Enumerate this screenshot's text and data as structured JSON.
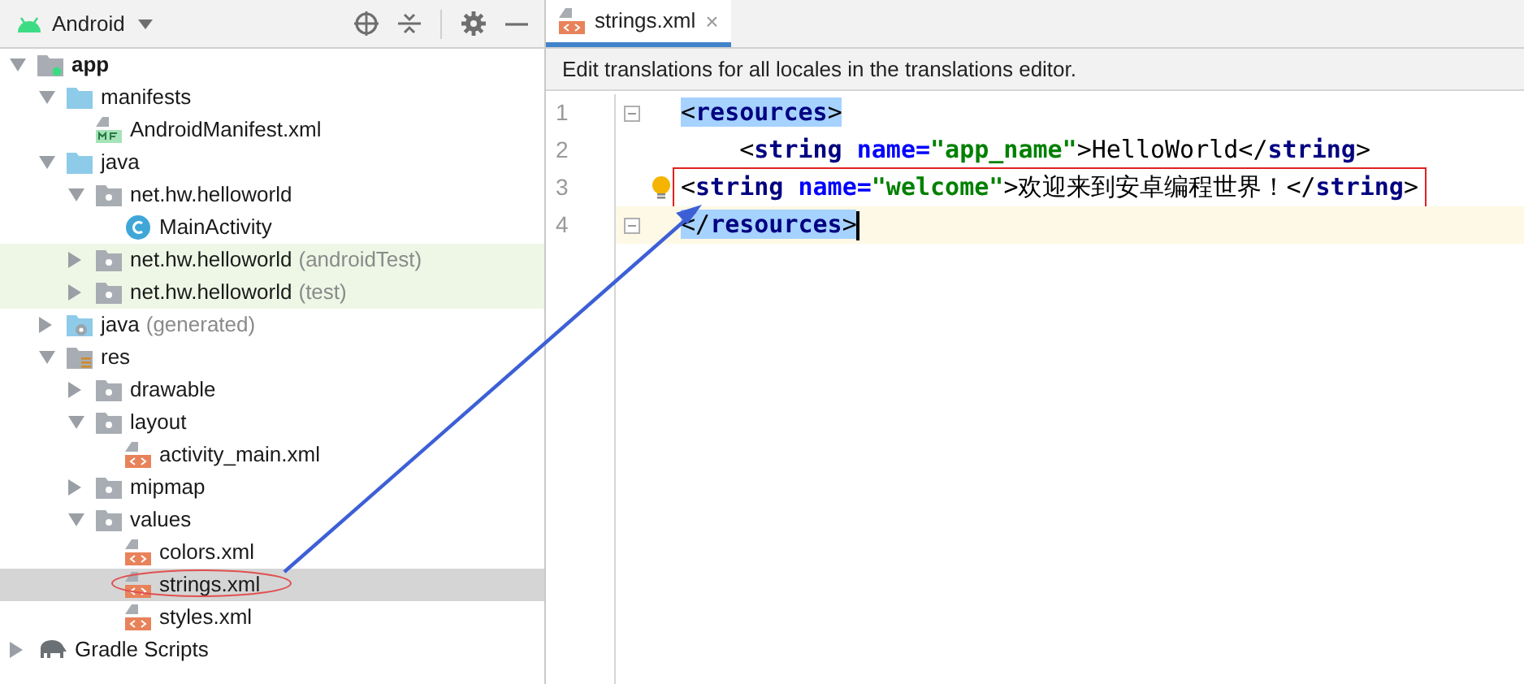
{
  "project_panel": {
    "view": "Android",
    "tree": [
      {
        "label": "app",
        "kind": "module",
        "expanded": true,
        "selected": false,
        "tinted": false,
        "children": [
          {
            "label": "manifests",
            "kind": "folder",
            "expanded": true,
            "selected": false,
            "tinted": false,
            "children": [
              {
                "label": "AndroidManifest.xml",
                "kind": "manifest",
                "selected": false,
                "tinted": false
              }
            ]
          },
          {
            "label": "java",
            "kind": "folder",
            "expanded": true,
            "selected": false,
            "tinted": false,
            "children": [
              {
                "label": "net.hw.helloworld",
                "kind": "package",
                "expanded": true,
                "selected": false,
                "tinted": false,
                "children": [
                  {
                    "label": "MainActivity",
                    "kind": "class",
                    "selected": false,
                    "tinted": false
                  }
                ]
              },
              {
                "label": "net.hw.helloworld",
                "suffix": "(androidTest)",
                "kind": "package",
                "expanded": false,
                "selected": false,
                "tinted": true
              },
              {
                "label": "net.hw.helloworld",
                "suffix": "(test)",
                "kind": "package",
                "expanded": false,
                "selected": false,
                "tinted": true
              }
            ]
          },
          {
            "label": "java",
            "suffix": "(generated)",
            "kind": "generated",
            "expanded": false,
            "selected": false,
            "tinted": false
          },
          {
            "label": "res",
            "kind": "res",
            "expanded": true,
            "selected": false,
            "tinted": false,
            "children": [
              {
                "label": "drawable",
                "kind": "package",
                "expanded": false,
                "selected": false,
                "tinted": false
              },
              {
                "label": "layout",
                "kind": "package",
                "expanded": true,
                "selected": false,
                "tinted": false,
                "children": [
                  {
                    "label": "activity_main.xml",
                    "kind": "xml",
                    "selected": false,
                    "tinted": false
                  }
                ]
              },
              {
                "label": "mipmap",
                "kind": "package",
                "expanded": false,
                "selected": false,
                "tinted": false
              },
              {
                "label": "values",
                "kind": "package",
                "expanded": true,
                "selected": false,
                "tinted": false,
                "children": [
                  {
                    "label": "colors.xml",
                    "kind": "xml",
                    "selected": false,
                    "tinted": false
                  },
                  {
                    "label": "strings.xml",
                    "kind": "xml",
                    "selected": true,
                    "tinted": false,
                    "circled": true
                  },
                  {
                    "label": "styles.xml",
                    "kind": "xml",
                    "selected": false,
                    "tinted": false
                  }
                ]
              }
            ]
          }
        ]
      },
      {
        "label": "Gradle Scripts",
        "kind": "gradle",
        "expanded": false,
        "selected": false,
        "tinted": false
      }
    ]
  },
  "editor": {
    "tabs": [
      {
        "label": "strings.xml",
        "selected": true
      }
    ],
    "close_glyph": "×",
    "banner": "Edit translations for all locales in the translations editor.",
    "lines": [
      {
        "number": "1",
        "current": false,
        "boxed": false,
        "bulb": false,
        "fold": true,
        "tokens": [
          {
            "kind": "sel",
            "text": "<"
          },
          {
            "kind": "seltag",
            "text": "resources"
          },
          {
            "kind": "sel",
            "text": ">"
          }
        ]
      },
      {
        "number": "2",
        "current": false,
        "boxed": false,
        "bulb": false,
        "fold": false,
        "tokens": [
          {
            "kind": "plain",
            "text": "    <"
          },
          {
            "kind": "tag",
            "text": "string"
          },
          {
            "kind": "attr",
            "text": " name="
          },
          {
            "kind": "value",
            "text": "\"app_name\""
          },
          {
            "kind": "plain",
            "text": ">HelloWorld</"
          },
          {
            "kind": "tag",
            "text": "string"
          },
          {
            "kind": "plain",
            "text": ">"
          }
        ]
      },
      {
        "number": "3",
        "current": false,
        "boxed": true,
        "bulb": true,
        "fold": false,
        "tokens": [
          {
            "kind": "plain",
            "text": "<"
          },
          {
            "kind": "tag",
            "text": "string"
          },
          {
            "kind": "attr",
            "text": " name="
          },
          {
            "kind": "value",
            "text": "\"welcome\""
          },
          {
            "kind": "plain",
            "text": ">欢迎来到安卓编程世界！</"
          },
          {
            "kind": "tag",
            "text": "string"
          },
          {
            "kind": "plain",
            "text": ">"
          }
        ]
      },
      {
        "number": "4",
        "current": true,
        "boxed": false,
        "bulb": false,
        "fold": true,
        "tokens": [
          {
            "kind": "sel",
            "text": "</"
          },
          {
            "kind": "seltag",
            "text": "resources"
          },
          {
            "kind": "sel",
            "text": ">"
          }
        ]
      }
    ]
  }
}
